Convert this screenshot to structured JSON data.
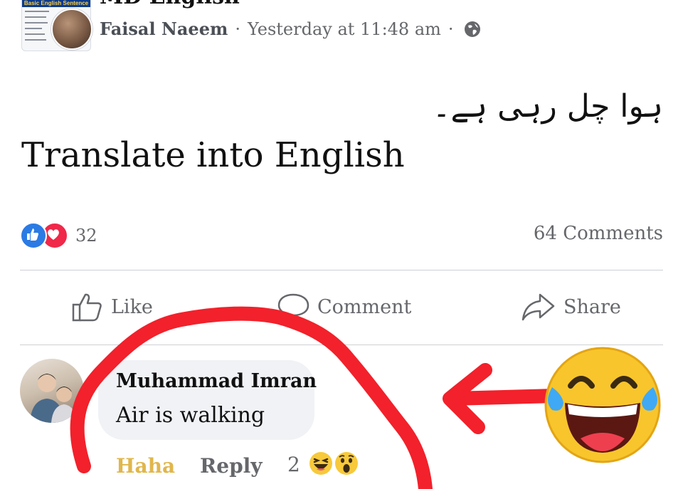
{
  "header": {
    "group_title": "MD English",
    "thumbnail_banner": "Basic English Sentence",
    "author": "Faisal Naeem",
    "separator": "·",
    "timestamp": "Yesterday at 11:48 am",
    "privacy_icon": "globe-icon",
    "close_icon": "close-icon"
  },
  "post": {
    "urdu_text": "ہوا چل رہی ہے۔",
    "text": "Translate into English"
  },
  "stats": {
    "reaction_icons": [
      "like-icon",
      "love-icon"
    ],
    "reaction_count": "32",
    "comments_label": "64 Comments"
  },
  "actions": {
    "like": "Like",
    "comment": "Comment",
    "share": "Share"
  },
  "comment": {
    "author": "Muhammad Imran",
    "text": "Air is walking",
    "reaction_label": "Haha",
    "reply_label": "Reply",
    "reaction_count": "2",
    "reaction_icons": [
      "haha-icon",
      "wow-icon"
    ]
  },
  "colors": {
    "annotation_red": "#f2212b",
    "like_blue": "#2b7be4",
    "love_red": "#f02849",
    "haha_yellow": "#e0b64c",
    "muted_text": "#65676b"
  }
}
